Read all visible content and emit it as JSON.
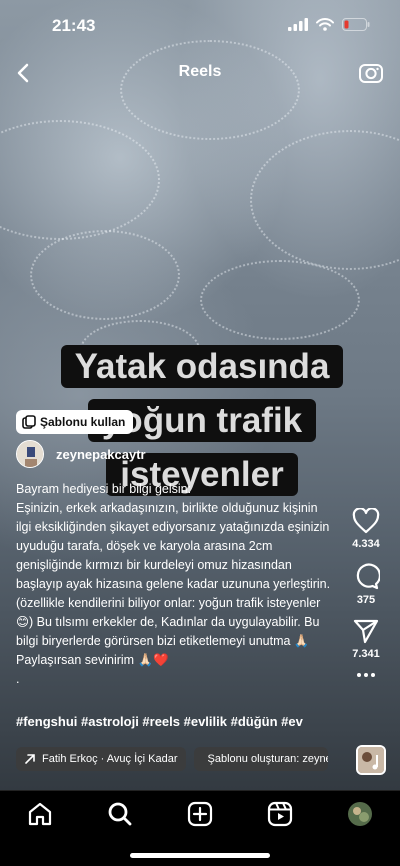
{
  "status_bar": {
    "time": "21:43"
  },
  "header": {
    "title": "Reels"
  },
  "overlay": {
    "line1": "Yatak odasında",
    "line2": "yoğun trafik",
    "line3": "isteyenler"
  },
  "template_button": {
    "label": "Şablonu kullan"
  },
  "user": {
    "username": "zeynepakcaytr"
  },
  "caption": "Bayram hediyesi bir bilgi gelsin:\nEşinizin, erkek arkadaşınızın, birlikte olduğunuz kişinin ilgi eksikliğinden şikayet ediyorsanız yatağınızda eşinizin uyuduğu tarafa, döşek ve karyola arasına 2cm genişliğinde kırmızı bir kurdeleyi  omuz hizasından başlayıp ayak hizasına gelene kadar uzununa yerleştirin. (özellikle kendilerini biliyor onlar: yoğun trafik isteyenler😊) Bu tılsımı erkekler de, Kadınlar da uygulayabilir. Bu bilgi biryerlerde görürsen bizi etiketlemeyi unutma 🙏🏻\nPaylaşırsan sevinirim 🙏🏻❤️\n.",
  "hashtags": "#fengshui #astroloji #reels #evlilik #düğün #ev",
  "chips": {
    "audio": "Fatih Erkoç · Avuç İçi Kadar",
    "template": "Şablonu oluşturan: zeynepakcaytr"
  },
  "actions": {
    "likes": "4.334",
    "comments": "375",
    "shares": "7.341"
  },
  "icons": {
    "back": "chevron-left-icon",
    "camera": "camera-icon",
    "like": "heart-icon",
    "comment": "comment-icon",
    "share": "send-icon",
    "more": "more-dots-icon",
    "home": "home-icon",
    "search": "search-icon",
    "create": "plus-square-icon",
    "reels": "reels-icon",
    "profile": "profile-avatar-icon"
  },
  "colors": {
    "template_button_bg": "#ffffff",
    "overlay_text_bg": "#0f0f0f",
    "like_heart": "#e0245e"
  }
}
